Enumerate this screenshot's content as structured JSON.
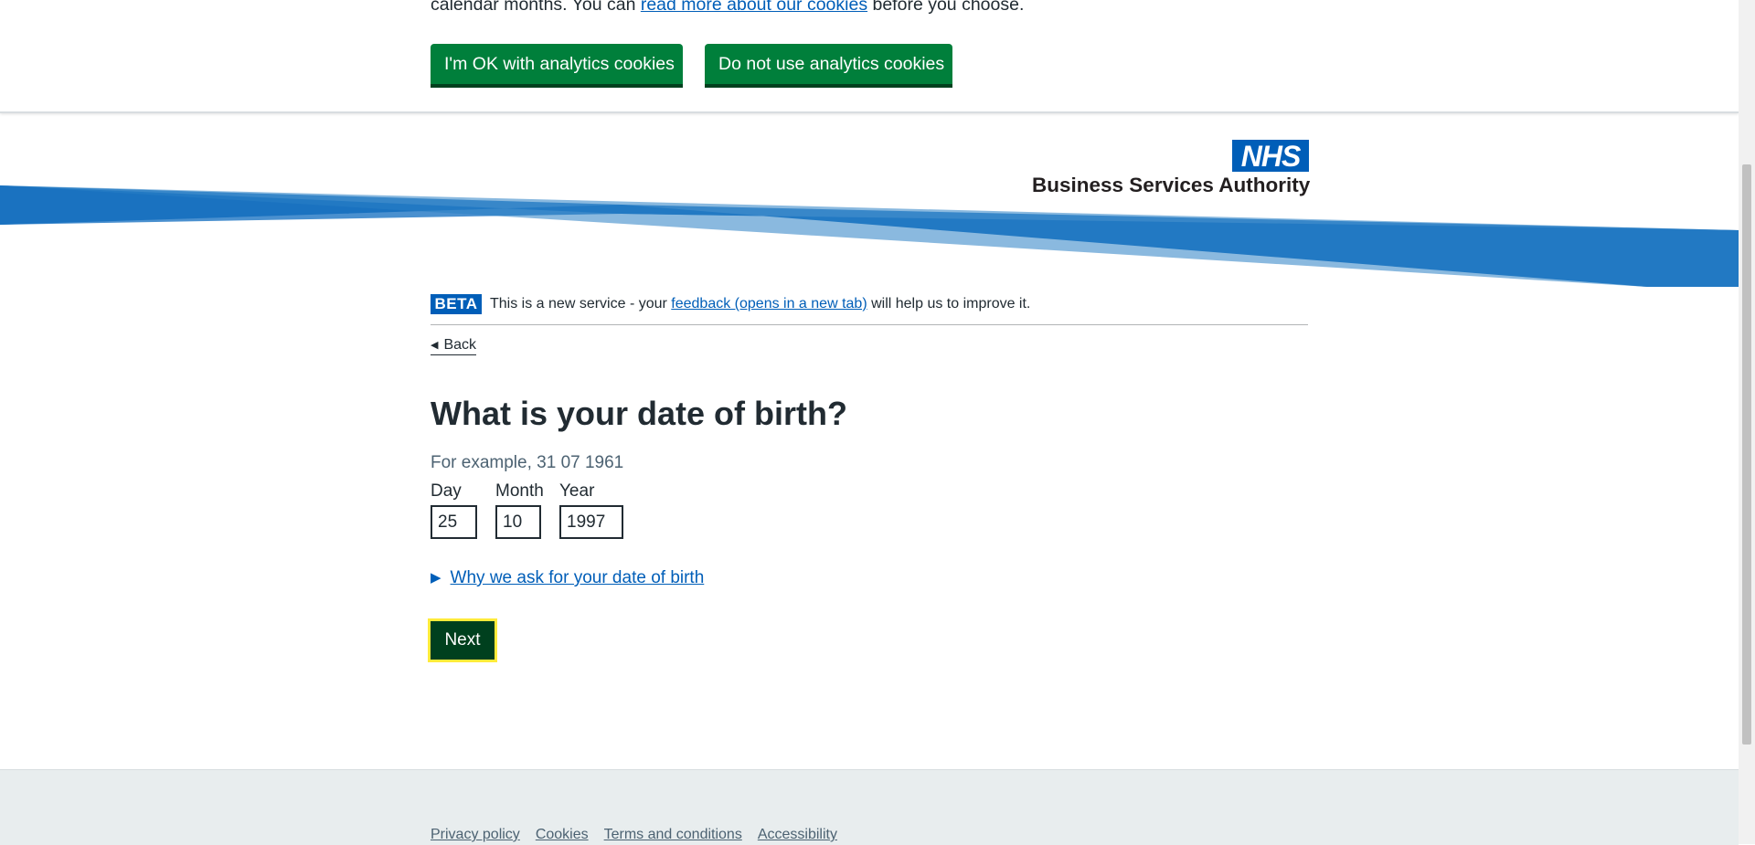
{
  "cookie_banner": {
    "text_before": "calendar months. You can ",
    "link_text": "read more about our cookies",
    "text_after": " before you choose.",
    "accept_label": "I'm OK with analytics cookies",
    "reject_label": "Do not use analytics cookies"
  },
  "header": {
    "logo_mark": "NHS",
    "org_name": "Business Services Authority"
  },
  "phase_banner": {
    "tag": "BETA",
    "text_before": "This is a new service - your ",
    "link_text": "feedback (opens in a new tab)",
    "text_after": " will help us to improve it."
  },
  "back_link": "Back",
  "question": {
    "title": "What is your date of birth?",
    "hint": "For example, 31 07 1961",
    "day_label": "Day",
    "day_value": "25",
    "month_label": "Month",
    "month_value": "10",
    "year_label": "Year",
    "year_value": "1997"
  },
  "details_summary": "Why we ask for your date of birth",
  "next_label": "Next",
  "footer": {
    "links": [
      "Privacy policy",
      "Cookies",
      "Terms and conditions",
      "Accessibility"
    ]
  },
  "colors": {
    "nhs_blue": "#005eb8",
    "button_green": "#007f3b",
    "focus_yellow": "#ffeb3b",
    "footer_grey": "#e8edee"
  }
}
